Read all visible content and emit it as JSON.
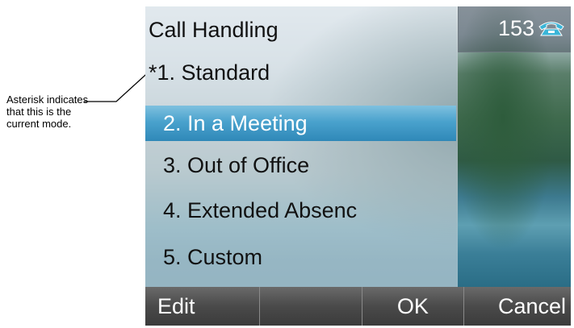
{
  "annotation": {
    "text": "Asterisk indicates that this is the current mode."
  },
  "screen": {
    "title": "Call Handling",
    "line_number": "153",
    "phone_icon": "phone-handset-icon",
    "items": [
      {
        "label": "*1.  Standard",
        "selected": false
      },
      {
        "label": "2.  In a Meeting",
        "selected": true
      },
      {
        "label": "3.  Out of Office",
        "selected": false
      },
      {
        "label": "4.  Extended Absenc",
        "selected": false
      },
      {
        "label": "5.  Custom",
        "selected": false
      }
    ],
    "softkeys": [
      "Edit",
      "",
      "OK",
      "Cancel"
    ]
  },
  "colors": {
    "selection": "#4aa2cd",
    "softkey_bar": "#4a4a4a",
    "phone_icon": "#3ab5d8"
  }
}
